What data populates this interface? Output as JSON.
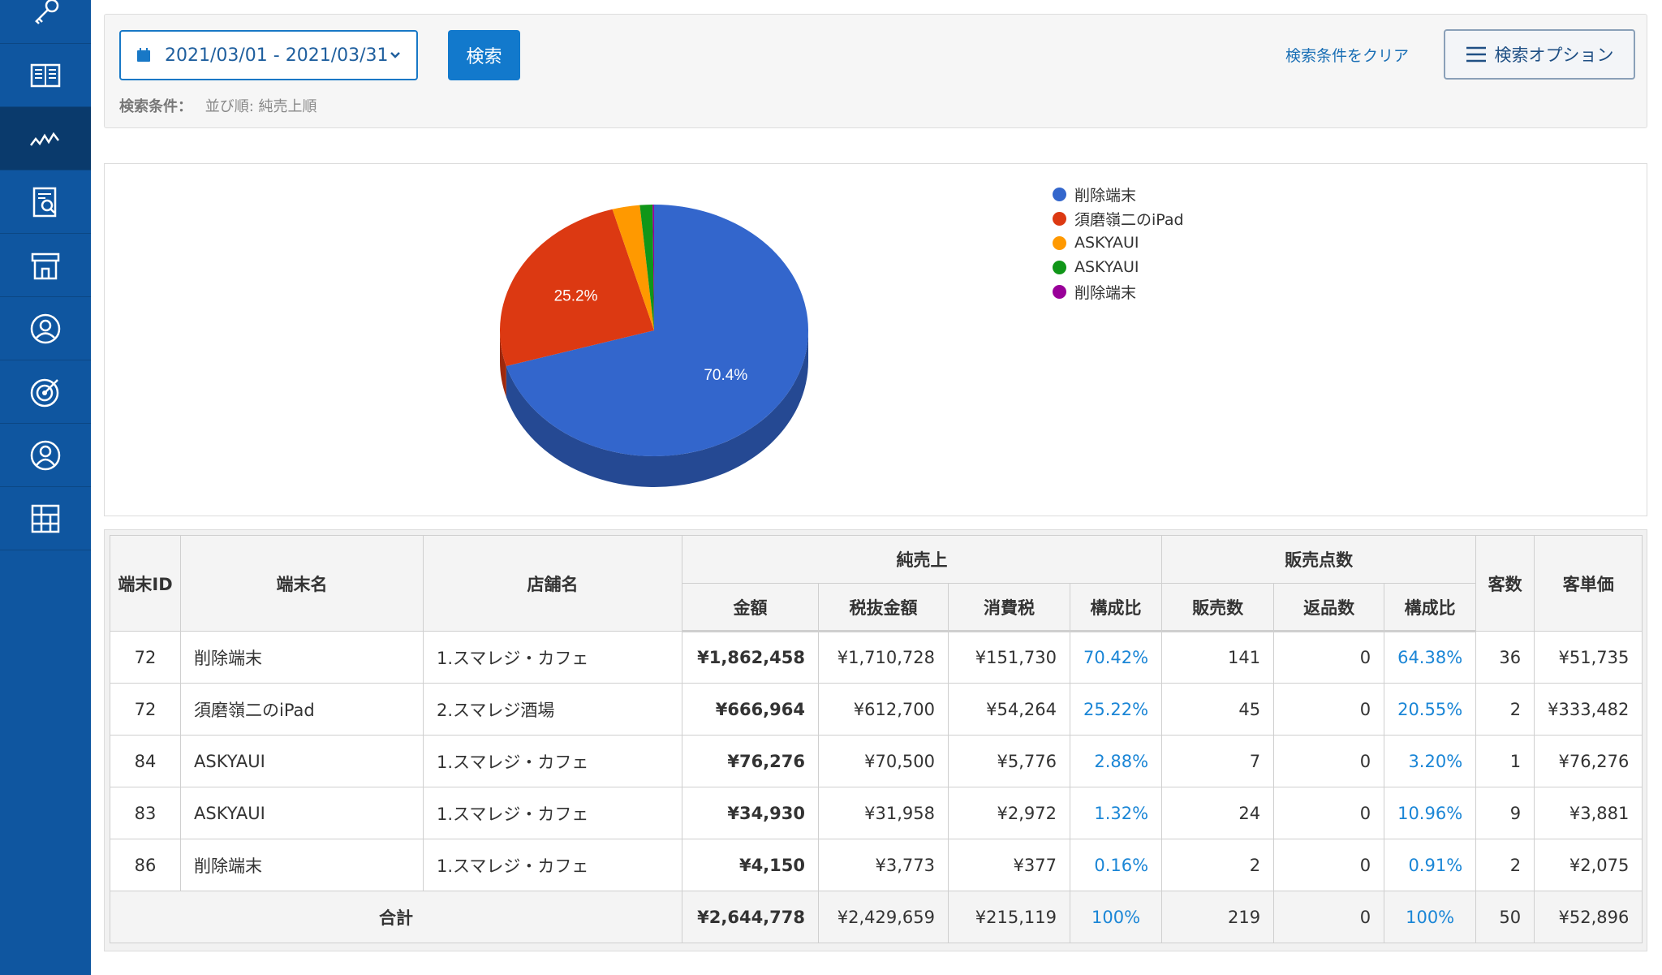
{
  "sidebar": {
    "items": [
      {
        "icon": "key-icon"
      },
      {
        "icon": "book-icon"
      },
      {
        "icon": "chart-line-icon",
        "active": true
      },
      {
        "icon": "report-search-icon"
      },
      {
        "icon": "store-icon"
      },
      {
        "icon": "user-circle-icon"
      },
      {
        "icon": "target-icon"
      },
      {
        "icon": "customer-icon"
      },
      {
        "icon": "grid-icon"
      }
    ]
  },
  "search": {
    "date_range": "2021/03/01 - 2021/03/31",
    "search_label": "検索",
    "conditions_label": "検索条件：",
    "conditions_value": "並び順: 純売上順",
    "clear_label": "検索条件をクリア",
    "options_label": "検索オプション"
  },
  "chart_data": {
    "type": "pie",
    "categories": [
      "削除端末",
      "須磨嶺二のiPad",
      "ASKYAUI",
      "ASKYAUI",
      "削除端末"
    ],
    "values": [
      70.42,
      25.22,
      2.88,
      1.32,
      0.16
    ],
    "colors": [
      "#3366cc",
      "#dc3912",
      "#ff9900",
      "#109618",
      "#990099"
    ],
    "data_labels": [
      "70.4%",
      "25.2%",
      "",
      "",
      ""
    ],
    "legend_position": "right",
    "style": "3d"
  },
  "table": {
    "headers": {
      "terminal_id": "端末ID",
      "terminal_name": "端末名",
      "store_name": "店舗名",
      "net_sales": "純売上",
      "amount": "金額",
      "ex_tax": "税抜金額",
      "tax": "消費税",
      "ratio": "構成比",
      "sales_count": "販売点数",
      "sold": "販売数",
      "returned": "返品数",
      "count_ratio": "構成比",
      "customers": "客数",
      "avg_price": "客単価"
    },
    "rows": [
      {
        "id": "72",
        "name": "削除端末",
        "store": "1.スマレジ・カフェ",
        "amount": "¥1,862,458",
        "ex_tax": "¥1,710,728",
        "tax": "¥151,730",
        "ratio": "70.42%",
        "sold": "141",
        "returned": "0",
        "count_ratio": "64.38%",
        "customers": "36",
        "avg": "¥51,735"
      },
      {
        "id": "72",
        "name": "須磨嶺二のiPad",
        "store": "2.スマレジ酒場",
        "amount": "¥666,964",
        "ex_tax": "¥612,700",
        "tax": "¥54,264",
        "ratio": "25.22%",
        "sold": "45",
        "returned": "0",
        "count_ratio": "20.55%",
        "customers": "2",
        "avg": "¥333,482"
      },
      {
        "id": "84",
        "name": "ASKYAUI",
        "store": "1.スマレジ・カフェ",
        "amount": "¥76,276",
        "ex_tax": "¥70,500",
        "tax": "¥5,776",
        "ratio": "2.88%",
        "sold": "7",
        "returned": "0",
        "count_ratio": "3.20%",
        "customers": "1",
        "avg": "¥76,276"
      },
      {
        "id": "83",
        "name": "ASKYAUI",
        "store": "1.スマレジ・カフェ",
        "amount": "¥34,930",
        "ex_tax": "¥31,958",
        "tax": "¥2,972",
        "ratio": "1.32%",
        "sold": "24",
        "returned": "0",
        "count_ratio": "10.96%",
        "customers": "9",
        "avg": "¥3,881"
      },
      {
        "id": "86",
        "name": "削除端末",
        "store": "1.スマレジ・カフェ",
        "amount": "¥4,150",
        "ex_tax": "¥3,773",
        "tax": "¥377",
        "ratio": "0.16%",
        "sold": "2",
        "returned": "0",
        "count_ratio": "0.91%",
        "customers": "2",
        "avg": "¥2,075"
      }
    ],
    "total": {
      "label": "合計",
      "amount": "¥2,644,778",
      "ex_tax": "¥2,429,659",
      "tax": "¥215,119",
      "ratio": "100%",
      "sold": "219",
      "returned": "0",
      "count_ratio": "100%",
      "customers": "50",
      "avg": "¥52,896"
    }
  }
}
